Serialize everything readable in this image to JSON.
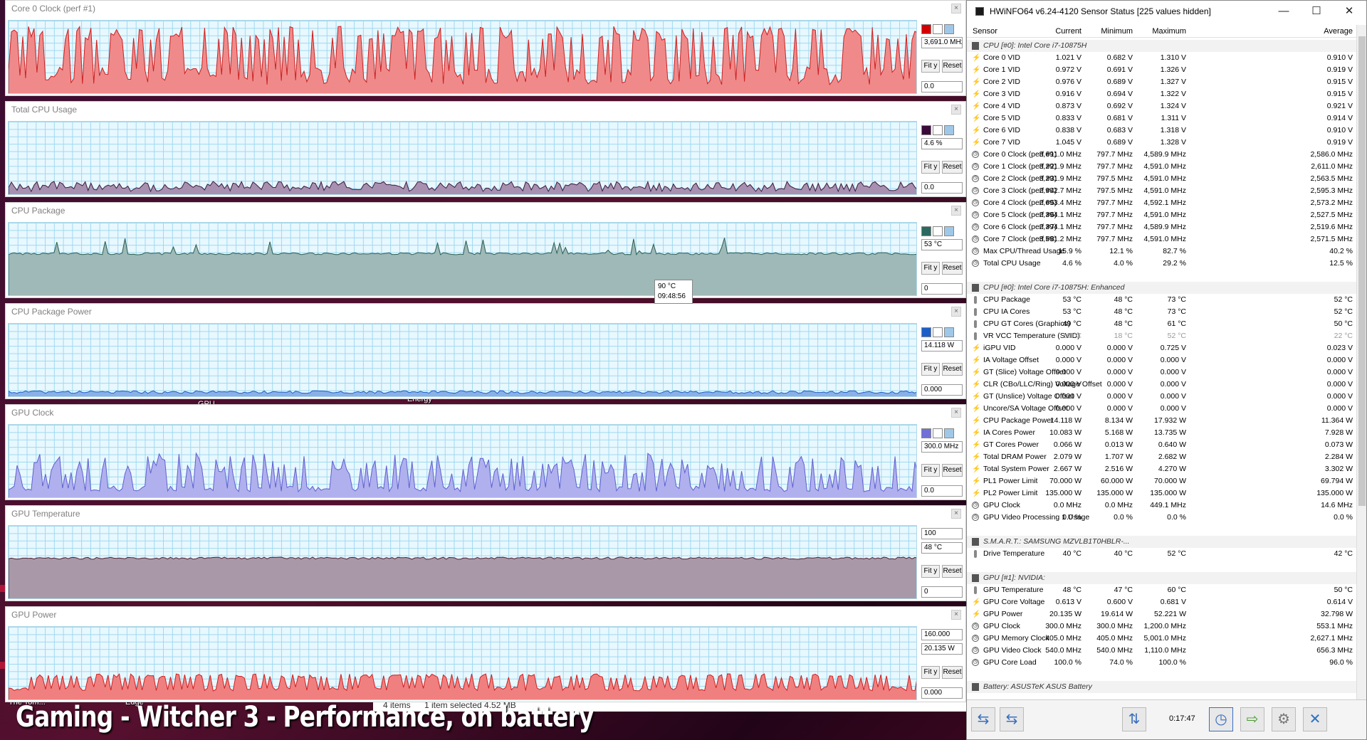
{
  "graphs": [
    {
      "title": "Core 0 Clock (perf #1)",
      "value": "3,691.0 MHz",
      "min": "0.0",
      "max": "",
      "fit": "Fit y",
      "reset": "Reset",
      "line": "#cc2020",
      "fill": "#f08a8a",
      "sw1": "#d40000",
      "sw2": "#ffffff",
      "sw3": "#9fc8e8"
    },
    {
      "title": "Total CPU Usage",
      "value": "4.6 %",
      "min": "0.0",
      "max": "",
      "fit": "Fit y",
      "reset": "Reset",
      "line": "#3a1a40",
      "fill": "#a890b0",
      "sw1": "#3a0a3a",
      "sw2": "#ffffff",
      "sw3": "#9fc8e8"
    },
    {
      "title": "CPU Package",
      "value": "53 °C",
      "min": "0",
      "max": "",
      "fit": "Fit y",
      "reset": "Reset",
      "line": "#2a6050",
      "fill": "#9fb8b8",
      "sw1": "#2a6a60",
      "sw2": "#ffffff",
      "sw3": "#9fc8e8"
    },
    {
      "title": "CPU Package Power",
      "value": "14.118 W",
      "min": "0.000",
      "max": "",
      "fit": "Fit y",
      "reset": "Reset",
      "line": "#1a60c8",
      "fill": "#8ab0e8",
      "sw1": "#1a60c8",
      "sw2": "#ffffff",
      "sw3": "#9fc8e8"
    },
    {
      "title": "GPU Clock",
      "value": "300.0 MHz",
      "min": "0.0",
      "max": "",
      "fit": "Fit y",
      "reset": "Reset",
      "line": "#6060d0",
      "fill": "#b0b0ee",
      "sw1": "#7070d8",
      "sw2": "#ffffff",
      "sw3": "#9fc8e8"
    },
    {
      "title": "GPU Temperature",
      "value": "48 °C",
      "min": "0",
      "max": "100",
      "fit": "Fit y",
      "reset": "Reset",
      "line": "#502030",
      "fill": "#a898a8",
      "sw1": "",
      "sw2": "",
      "sw3": ""
    },
    {
      "title": "GPU Power",
      "value": "20.135 W",
      "min": "0.000",
      "max": "160.000",
      "fit": "Fit y",
      "reset": "Reset",
      "line": "#d02020",
      "fill": "#f08080",
      "sw1": "",
      "sw2": "",
      "sw3": ""
    }
  ],
  "tooltip": {
    "line1": "90 °C",
    "line2": "09:48:56"
  },
  "desktop": {
    "caption": "Gaming - Witcher 3 - Performance, on battery",
    "label_tom": "The Tom...",
    "label_edge": "Edge",
    "label_energy": "Energy",
    "label_gpu": "GPU",
    "explorer_items": "4 items",
    "explorer_selected": "1 item selected  4.52 MB"
  },
  "hwinfo": {
    "title": "HWiNFO64 v6.24-4120 Sensor Status [225 values hidden]",
    "win_min": "—",
    "win_max": "☐",
    "win_close": "✕",
    "columns": [
      "Sensor",
      "Current",
      "Minimum",
      "Maximum",
      "Average"
    ],
    "rows": [
      {
        "t": "group",
        "n": "CPU [#0]: Intel Core i7-10875H"
      },
      {
        "t": "volt",
        "n": "Core 0 VID",
        "c": "1.021 V",
        "mi": "0.682 V",
        "ma": "1.310 V",
        "av": "0.910 V"
      },
      {
        "t": "volt",
        "n": "Core 1 VID",
        "c": "0.972 V",
        "mi": "0.691 V",
        "ma": "1.326 V",
        "av": "0.919 V"
      },
      {
        "t": "volt",
        "n": "Core 2 VID",
        "c": "0.976 V",
        "mi": "0.689 V",
        "ma": "1.327 V",
        "av": "0.915 V"
      },
      {
        "t": "volt",
        "n": "Core 3 VID",
        "c": "0.916 V",
        "mi": "0.694 V",
        "ma": "1.322 V",
        "av": "0.915 V"
      },
      {
        "t": "volt",
        "n": "Core 4 VID",
        "c": "0.873 V",
        "mi": "0.692 V",
        "ma": "1.324 V",
        "av": "0.921 V"
      },
      {
        "t": "volt",
        "n": "Core 5 VID",
        "c": "0.833 V",
        "mi": "0.681 V",
        "ma": "1.311 V",
        "av": "0.914 V"
      },
      {
        "t": "volt",
        "n": "Core 6 VID",
        "c": "0.838 V",
        "mi": "0.683 V",
        "ma": "1.318 V",
        "av": "0.910 V"
      },
      {
        "t": "volt",
        "n": "Core 7 VID",
        "c": "1.045 V",
        "mi": "0.689 V",
        "ma": "1.328 V",
        "av": "0.919 V"
      },
      {
        "t": "clock",
        "n": "Core 0 Clock (perf #1)",
        "c": "3,691.0 MHz",
        "mi": "797.7 MHz",
        "ma": "4,589.9 MHz",
        "av": "2,586.0 MHz"
      },
      {
        "t": "clock",
        "n": "Core 1 Clock (perf #2)",
        "c": "3,291.9 MHz",
        "mi": "797.7 MHz",
        "ma": "4,591.0 MHz",
        "av": "2,611.0 MHz"
      },
      {
        "t": "clock",
        "n": "Core 2 Clock (perf #3)",
        "c": "3,291.9 MHz",
        "mi": "797.5 MHz",
        "ma": "4,591.0 MHz",
        "av": "2,563.5 MHz"
      },
      {
        "t": "clock",
        "n": "Core 3 Clock (perf #4)",
        "c": "2,992.7 MHz",
        "mi": "797.5 MHz",
        "ma": "4,591.0 MHz",
        "av": "2,595.3 MHz"
      },
      {
        "t": "clock",
        "n": "Core 4 Clock (perf #5)",
        "c": "2,693.4 MHz",
        "mi": "797.7 MHz",
        "ma": "4,592.1 MHz",
        "av": "2,573.2 MHz"
      },
      {
        "t": "clock",
        "n": "Core 5 Clock (perf #6)",
        "c": "2,394.1 MHz",
        "mi": "797.7 MHz",
        "ma": "4,591.0 MHz",
        "av": "2,527.5 MHz"
      },
      {
        "t": "clock",
        "n": "Core 6 Clock (perf #7)",
        "c": "2,394.1 MHz",
        "mi": "797.7 MHz",
        "ma": "4,589.9 MHz",
        "av": "2,519.6 MHz"
      },
      {
        "t": "clock",
        "n": "Core 7 Clock (perf #8)",
        "c": "3,591.2 MHz",
        "mi": "797.7 MHz",
        "ma": "4,591.0 MHz",
        "av": "2,571.5 MHz"
      },
      {
        "t": "clock",
        "n": "Max CPU/Thread Usage",
        "c": "15.9 %",
        "mi": "12.1 %",
        "ma": "82.7 %",
        "av": "40.2 %"
      },
      {
        "t": "clock",
        "n": "Total CPU Usage",
        "c": "4.6 %",
        "mi": "4.0 %",
        "ma": "29.2 %",
        "av": "12.5 %"
      },
      {
        "t": "blank"
      },
      {
        "t": "group",
        "n": "CPU [#0]: Intel Core i7-10875H: Enhanced"
      },
      {
        "t": "temp",
        "n": "CPU Package",
        "c": "53 °C",
        "mi": "48 °C",
        "ma": "73 °C",
        "av": "52 °C"
      },
      {
        "t": "temp",
        "n": "CPU IA Cores",
        "c": "53 °C",
        "mi": "48 °C",
        "ma": "73 °C",
        "av": "52 °C"
      },
      {
        "t": "temp",
        "n": "CPU GT Cores (Graphics)",
        "c": "49 °C",
        "mi": "48 °C",
        "ma": "61 °C",
        "av": "50 °C"
      },
      {
        "t": "temp",
        "n": "VR VCC Temperature (SVID)",
        "c": "19 °C",
        "mi": "18 °C",
        "ma": "52 °C",
        "av": "22 °C",
        "dim": true
      },
      {
        "t": "volt",
        "n": "iGPU VID",
        "c": "0.000 V",
        "mi": "0.000 V",
        "ma": "0.725 V",
        "av": "0.023 V"
      },
      {
        "t": "volt",
        "n": "IA Voltage Offset",
        "c": "0.000 V",
        "mi": "0.000 V",
        "ma": "0.000 V",
        "av": "0.000 V"
      },
      {
        "t": "volt",
        "n": "GT (Slice) Voltage Offset",
        "c": "0.000 V",
        "mi": "0.000 V",
        "ma": "0.000 V",
        "av": "0.000 V"
      },
      {
        "t": "volt",
        "n": "CLR (CBo/LLC/Ring) Voltage Offset",
        "c": "0.000 V",
        "mi": "0.000 V",
        "ma": "0.000 V",
        "av": "0.000 V"
      },
      {
        "t": "volt",
        "n": "GT (Unslice) Voltage Offset",
        "c": "0.000 V",
        "mi": "0.000 V",
        "ma": "0.000 V",
        "av": "0.000 V"
      },
      {
        "t": "volt",
        "n": "Uncore/SA Voltage Offset",
        "c": "0.000 V",
        "mi": "0.000 V",
        "ma": "0.000 V",
        "av": "0.000 V"
      },
      {
        "t": "volt",
        "n": "CPU Package Power",
        "c": "14.118 W",
        "mi": "8.134 W",
        "ma": "17.932 W",
        "av": "11.364 W"
      },
      {
        "t": "volt",
        "n": "IA Cores Power",
        "c": "10.083 W",
        "mi": "5.168 W",
        "ma": "13.735 W",
        "av": "7.928 W"
      },
      {
        "t": "volt",
        "n": "GT Cores Power",
        "c": "0.066 W",
        "mi": "0.013 W",
        "ma": "0.640 W",
        "av": "0.073 W"
      },
      {
        "t": "volt",
        "n": "Total DRAM Power",
        "c": "2.079 W",
        "mi": "1.707 W",
        "ma": "2.682 W",
        "av": "2.284 W"
      },
      {
        "t": "volt",
        "n": "Total System Power",
        "c": "2.667 W",
        "mi": "2.516 W",
        "ma": "4.270 W",
        "av": "3.302 W"
      },
      {
        "t": "volt",
        "n": "PL1 Power Limit",
        "c": "70.000 W",
        "mi": "60.000 W",
        "ma": "70.000 W",
        "av": "69.794 W"
      },
      {
        "t": "volt",
        "n": "PL2 Power Limit",
        "c": "135.000 W",
        "mi": "135.000 W",
        "ma": "135.000 W",
        "av": "135.000 W"
      },
      {
        "t": "clock",
        "n": "GPU Clock",
        "c": "0.0 MHz",
        "mi": "0.0 MHz",
        "ma": "449.1 MHz",
        "av": "14.6 MHz"
      },
      {
        "t": "clock",
        "n": "GPU Video Processing 1 Usage",
        "c": "0.0 %",
        "mi": "0.0 %",
        "ma": "0.0 %",
        "av": "0.0 %"
      },
      {
        "t": "blank"
      },
      {
        "t": "group",
        "n": "S.M.A.R.T.: SAMSUNG MZVLB1T0HBLR-..."
      },
      {
        "t": "temp",
        "n": "Drive Temperature",
        "c": "40 °C",
        "mi": "40 °C",
        "ma": "52 °C",
        "av": "42 °C"
      },
      {
        "t": "blank"
      },
      {
        "t": "group",
        "n": "GPU [#1]: NVIDIA:"
      },
      {
        "t": "temp",
        "n": "GPU Temperature",
        "c": "48 °C",
        "mi": "47 °C",
        "ma": "60 °C",
        "av": "50 °C"
      },
      {
        "t": "volt",
        "n": "GPU Core Voltage",
        "c": "0.613 V",
        "mi": "0.600 V",
        "ma": "0.681 V",
        "av": "0.614 V"
      },
      {
        "t": "volt",
        "n": "GPU Power",
        "c": "20.135 W",
        "mi": "19.614 W",
        "ma": "52.221 W",
        "av": "32.798 W"
      },
      {
        "t": "clock",
        "n": "GPU Clock",
        "c": "300.0 MHz",
        "mi": "300.0 MHz",
        "ma": "1,200.0 MHz",
        "av": "553.1 MHz"
      },
      {
        "t": "clock",
        "n": "GPU Memory Clock",
        "c": "405.0 MHz",
        "mi": "405.0 MHz",
        "ma": "5,001.0 MHz",
        "av": "2,627.1 MHz"
      },
      {
        "t": "clock",
        "n": "GPU Video Clock",
        "c": "540.0 MHz",
        "mi": "540.0 MHz",
        "ma": "1,110.0 MHz",
        "av": "656.3 MHz"
      },
      {
        "t": "clock",
        "n": "GPU Core Load",
        "c": "100.0 %",
        "mi": "74.0 %",
        "ma": "100.0 %",
        "av": "96.0 %"
      },
      {
        "t": "blank"
      },
      {
        "t": "group",
        "n": "Battery: ASUSTeK ASUS Battery"
      }
    ],
    "toolbar": {
      "timer": "0:17:47",
      "nav_left_icon": "⇆",
      "nav_right_icon": "⇆",
      "network_icon": "⇅",
      "clock_icon": "◷",
      "export_icon": "⇨",
      "settings_icon": "⚙",
      "close_icon": "✕"
    }
  }
}
